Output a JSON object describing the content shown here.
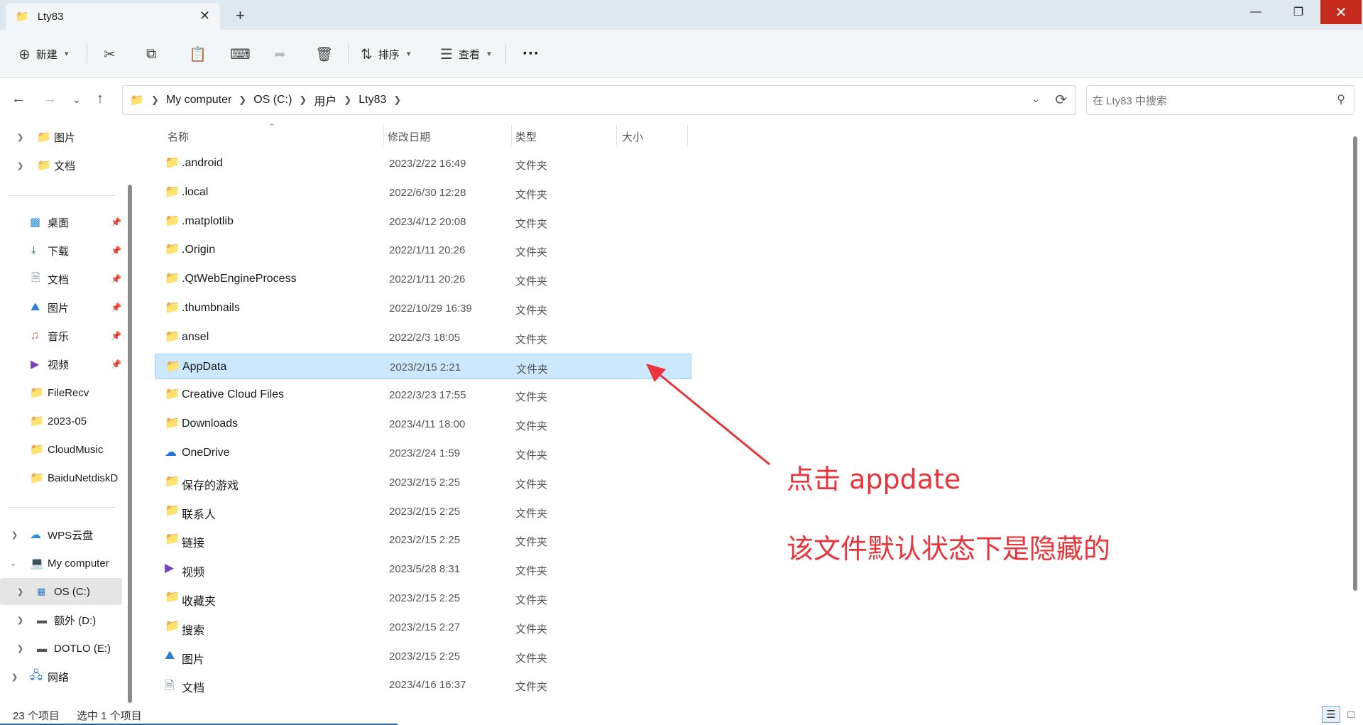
{
  "window": {
    "tab_title": "Lty83",
    "tab_close": "✕",
    "new_tab": "+",
    "min": "—",
    "max": "❐",
    "close": "✕"
  },
  "toolbar": {
    "new_label": "新建",
    "sort_label": "排序",
    "view_label": "查看",
    "more": "···"
  },
  "address": {
    "crumbs": [
      "My computer",
      "OS (C:)",
      "用户",
      "Lty83"
    ],
    "search_placeholder": "在 Lty83 中搜索"
  },
  "sidebar": {
    "top_items": [
      {
        "label": "图片",
        "icon": "folder-icon"
      },
      {
        "label": "文档",
        "icon": "folder-icon"
      }
    ],
    "quick_access": [
      {
        "label": "桌面",
        "icon": "desktop-icon",
        "pinned": true
      },
      {
        "label": "下载",
        "icon": "download-icon",
        "pinned": true
      },
      {
        "label": "文档",
        "icon": "document-icon",
        "pinned": true
      },
      {
        "label": "图片",
        "icon": "pictures-icon",
        "pinned": true
      },
      {
        "label": "音乐",
        "icon": "music-icon",
        "pinned": true
      },
      {
        "label": "视频",
        "icon": "video-icon",
        "pinned": true
      },
      {
        "label": "FileRecv",
        "icon": "folder-icon",
        "pinned": false
      },
      {
        "label": "2023-05",
        "icon": "folder-icon",
        "pinned": false
      },
      {
        "label": "CloudMusic",
        "icon": "folder-icon",
        "pinned": false
      },
      {
        "label": "BaiduNetdiskD",
        "icon": "folder-icon",
        "pinned": false
      }
    ],
    "tree": [
      {
        "label": "WPS云盘",
        "icon": "cloud-icon"
      },
      {
        "label": "My computer",
        "icon": "computer-icon"
      },
      {
        "label": "OS (C:)",
        "icon": "windows-drive-icon"
      },
      {
        "label": "额外 (D:)",
        "icon": "drive-icon"
      },
      {
        "label": "DOTLO (E:)",
        "icon": "drive-icon"
      },
      {
        "label": "网络",
        "icon": "network-icon"
      }
    ]
  },
  "columns": {
    "name": "名称",
    "date": "修改日期",
    "type": "类型",
    "size": "大小"
  },
  "files": [
    {
      "name": ".android",
      "date": "2023/2/22 16:49",
      "type": "文件夹",
      "icon": "folder-icon"
    },
    {
      "name": ".local",
      "date": "2022/6/30 12:28",
      "type": "文件夹",
      "icon": "folder-icon"
    },
    {
      "name": ".matplotlib",
      "date": "2023/4/12 20:08",
      "type": "文件夹",
      "icon": "folder-icon"
    },
    {
      "name": ".Origin",
      "date": "2022/1/11 20:26",
      "type": "文件夹",
      "icon": "folder-icon"
    },
    {
      "name": ".QtWebEngineProcess",
      "date": "2022/1/11 20:26",
      "type": "文件夹",
      "icon": "folder-icon"
    },
    {
      "name": ".thumbnails",
      "date": "2022/10/29 16:39",
      "type": "文件夹",
      "icon": "folder-icon"
    },
    {
      "name": "ansel",
      "date": "2022/2/3 18:05",
      "type": "文件夹",
      "icon": "folder-icon"
    },
    {
      "name": "AppData",
      "date": "2023/2/15 2:21",
      "type": "文件夹",
      "icon": "folder-icon",
      "selected": true
    },
    {
      "name": "Creative Cloud Files",
      "date": "2022/3/23 17:55",
      "type": "文件夹",
      "icon": "folder-icon"
    },
    {
      "name": "Downloads",
      "date": "2023/4/11 18:00",
      "type": "文件夹",
      "icon": "folder-icon"
    },
    {
      "name": "OneDrive",
      "date": "2023/2/24 1:59",
      "type": "文件夹",
      "icon": "onedrive-icon"
    },
    {
      "name": "保存的游戏",
      "date": "2023/2/15 2:25",
      "type": "文件夹",
      "icon": "folder-icon"
    },
    {
      "name": "联系人",
      "date": "2023/2/15 2:25",
      "type": "文件夹",
      "icon": "folder-icon"
    },
    {
      "name": "链接",
      "date": "2023/2/15 2:25",
      "type": "文件夹",
      "icon": "folder-icon"
    },
    {
      "name": "视频",
      "date": "2023/5/28 8:31",
      "type": "文件夹",
      "icon": "video-icon"
    },
    {
      "name": "收藏夹",
      "date": "2023/2/15 2:25",
      "type": "文件夹",
      "icon": "folder-icon"
    },
    {
      "name": "搜索",
      "date": "2023/2/15 2:27",
      "type": "文件夹",
      "icon": "folder-icon"
    },
    {
      "name": "图片",
      "date": "2023/2/15 2:25",
      "type": "文件夹",
      "icon": "pictures-icon"
    },
    {
      "name": "文档",
      "date": "2023/4/16 16:37",
      "type": "文件夹",
      "icon": "document-icon"
    }
  ],
  "annotation": {
    "line1": "点击  appdate",
    "line2": "该文件默认状态下是隐藏的",
    "color": "#e8343a"
  },
  "status": {
    "count": "23 个项目",
    "selected": "选中 1 个项目"
  },
  "colors": {
    "selection": "#cce8ff",
    "folder": "#f3c34f",
    "close_button": "#c42b1c"
  }
}
